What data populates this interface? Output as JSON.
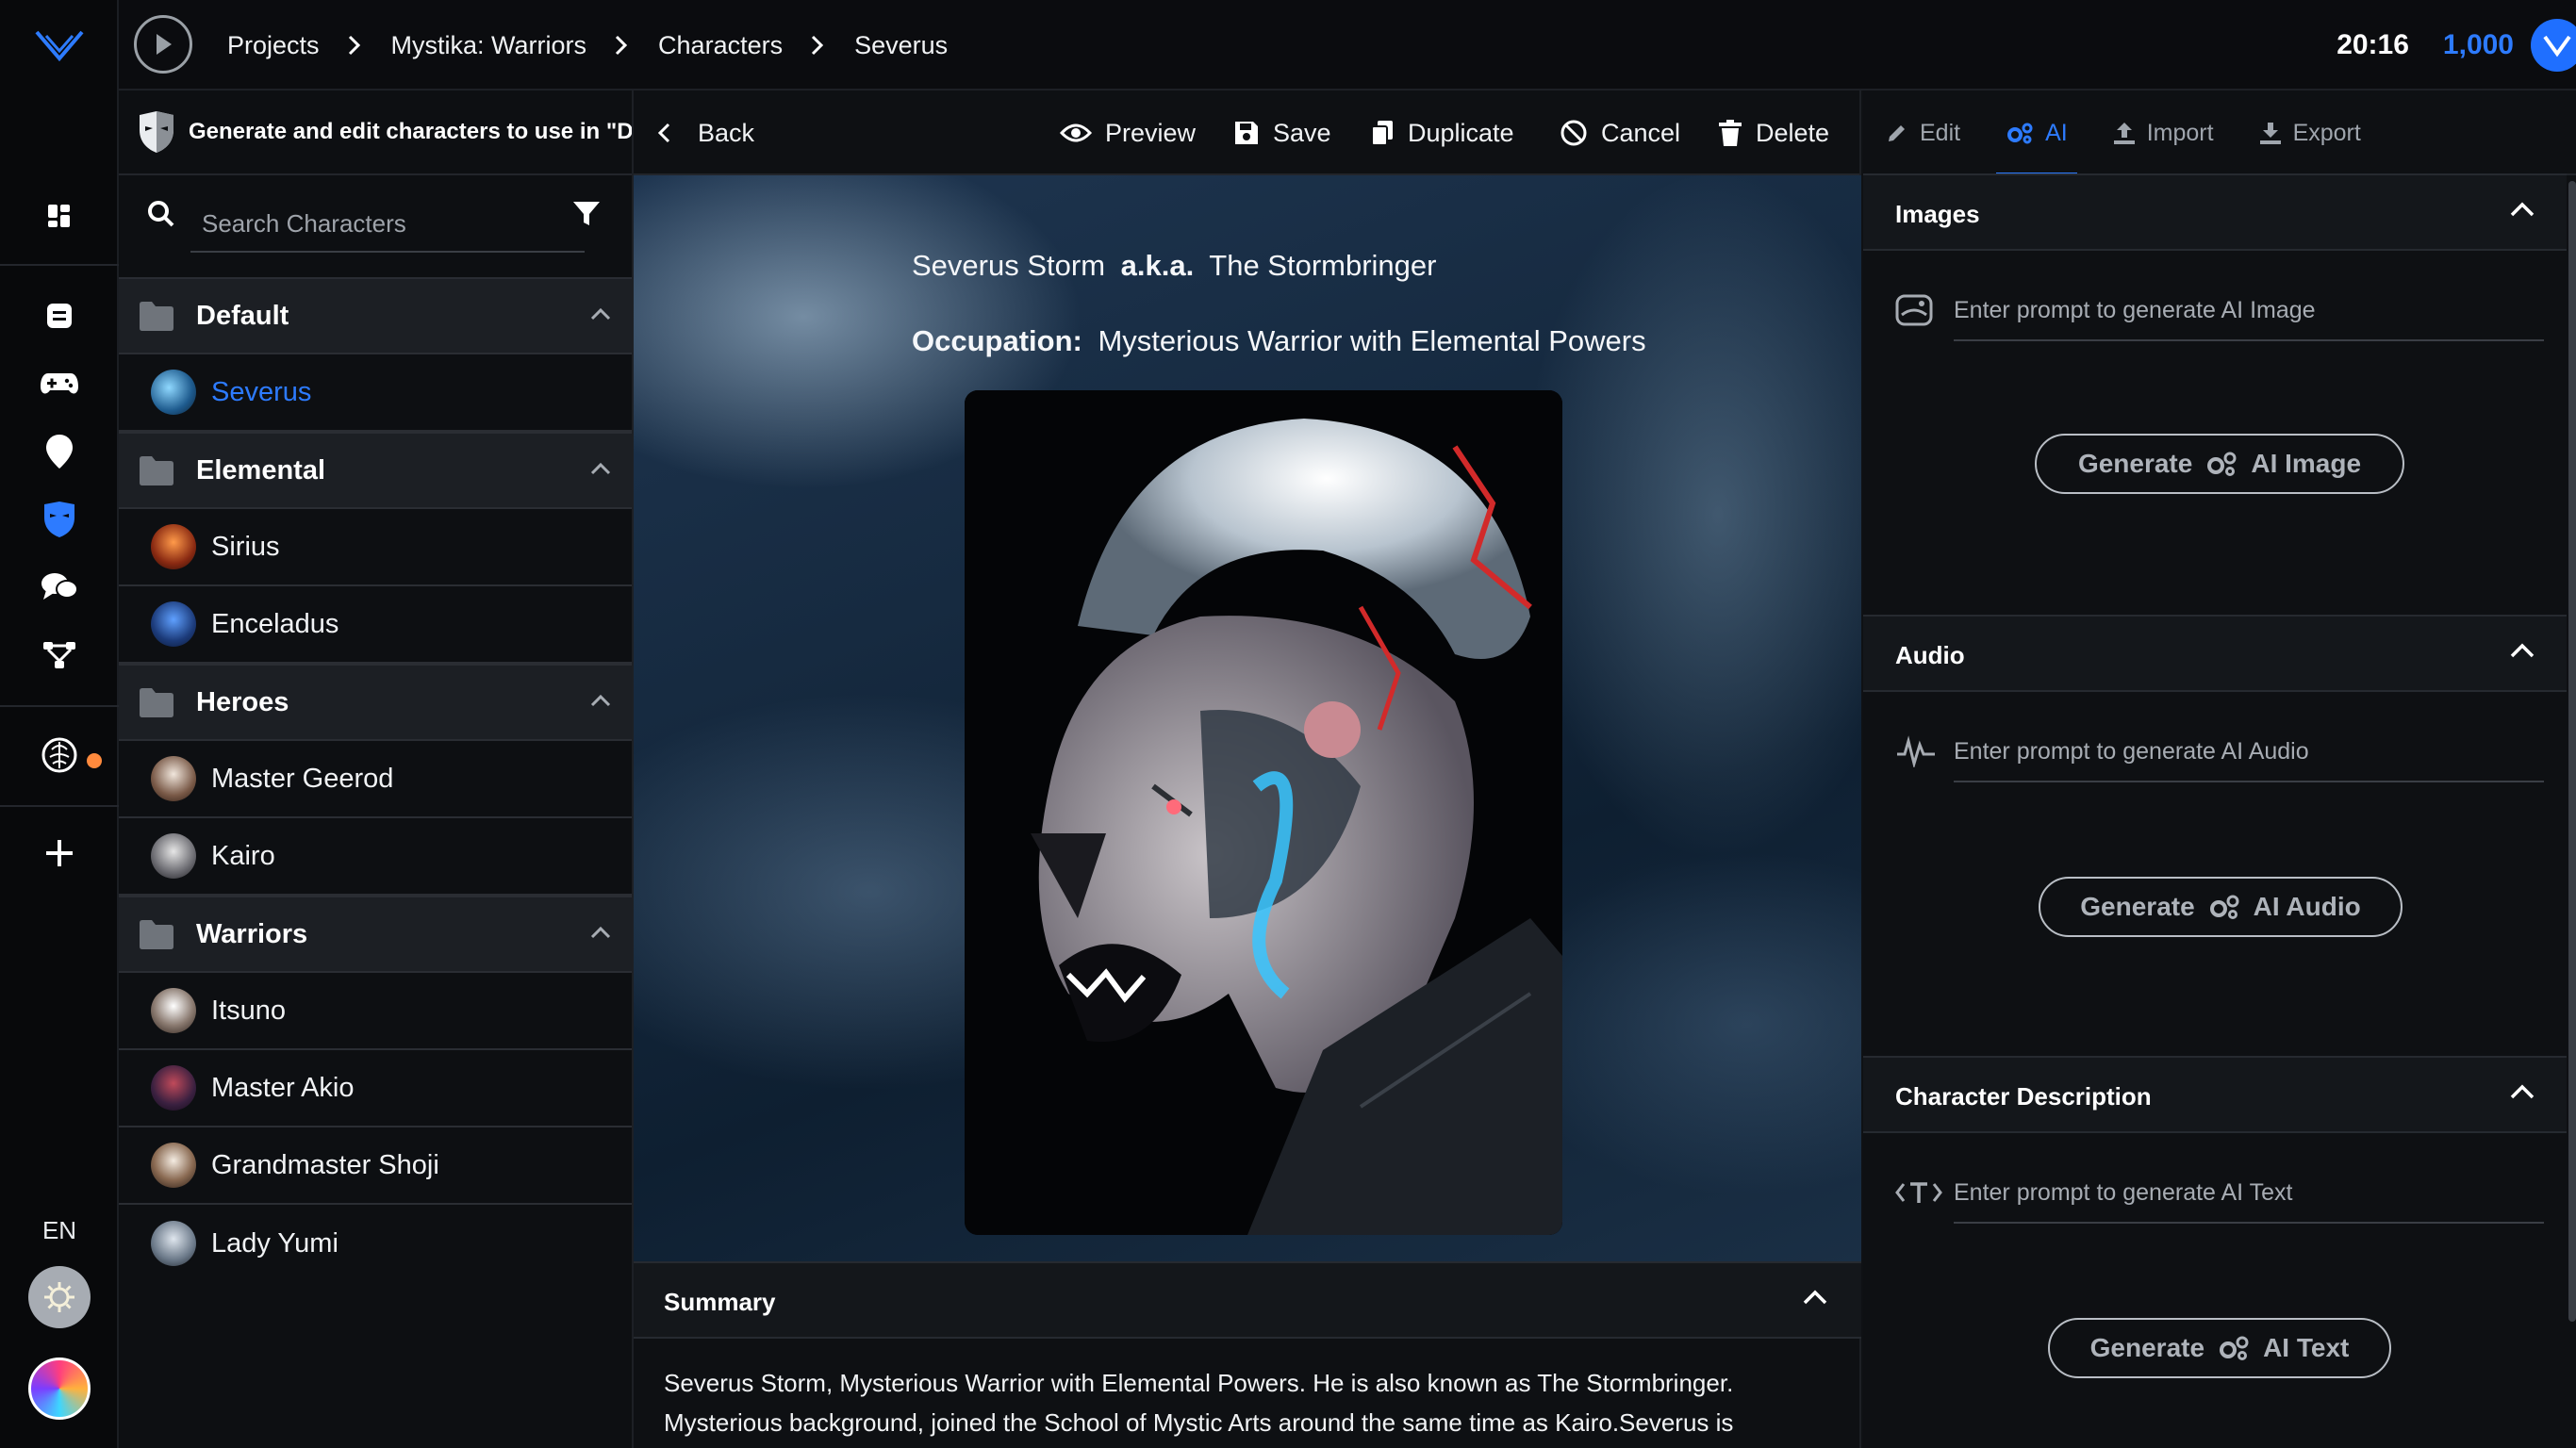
{
  "topbar": {
    "breadcrumbs": [
      "Projects",
      "Mystika: Warriors",
      "Characters",
      "Severus"
    ],
    "clock": "20:16",
    "credits": "1,000"
  },
  "rail": {
    "language": "EN"
  },
  "list_panel": {
    "header": "Generate and edit characters to use in \"Dial",
    "search_placeholder": "Search Characters",
    "groups": [
      {
        "name": "Default",
        "items": [
          "Severus"
        ]
      },
      {
        "name": "Elemental",
        "items": [
          "Sirius",
          "Enceladus"
        ]
      },
      {
        "name": "Heroes",
        "items": [
          "Master Geerod",
          "Kairo"
        ]
      },
      {
        "name": "Warriors",
        "items": [
          "Itsuno",
          "Master Akio",
          "Grandmaster Shoji",
          "Lady Yumi"
        ]
      }
    ],
    "active_item": "Severus"
  },
  "toolbar": {
    "back": "Back",
    "preview": "Preview",
    "save": "Save",
    "duplicate": "Duplicate",
    "cancel": "Cancel",
    "delete": "Delete"
  },
  "character": {
    "name": "Severus Storm",
    "aka_label": "a.k.a.",
    "alias": "The Stormbringer",
    "occupation_label": "Occupation:",
    "occupation": "Mysterious Warrior with Elemental Powers"
  },
  "summary": {
    "title": "Summary",
    "text_line1": "Severus Storm, Mysterious Warrior with Elemental Powers. He is also known as The Stormbringer.",
    "text_line2": "Mysterious background, joined the School of Mystic Arts around the same time as Kairo.Severus is"
  },
  "right_tabs": [
    "Edit",
    "AI",
    "Import",
    "Export"
  ],
  "active_tab": "AI",
  "ai": {
    "images": {
      "title": "Images",
      "placeholder": "Enter prompt to generate AI Image",
      "button_prefix": "Generate",
      "button_suffix": "AI Image"
    },
    "audio": {
      "title": "Audio",
      "placeholder": "Enter prompt to generate AI Audio",
      "button_prefix": "Generate",
      "button_suffix": "AI Audio"
    },
    "description": {
      "title": "Character Description",
      "placeholder": "Enter prompt to generate AI Text",
      "button_prefix": "Generate",
      "button_suffix": "AI Text"
    }
  },
  "colors": {
    "accent": "#2d7bff",
    "notification": "#ff8a3d"
  }
}
